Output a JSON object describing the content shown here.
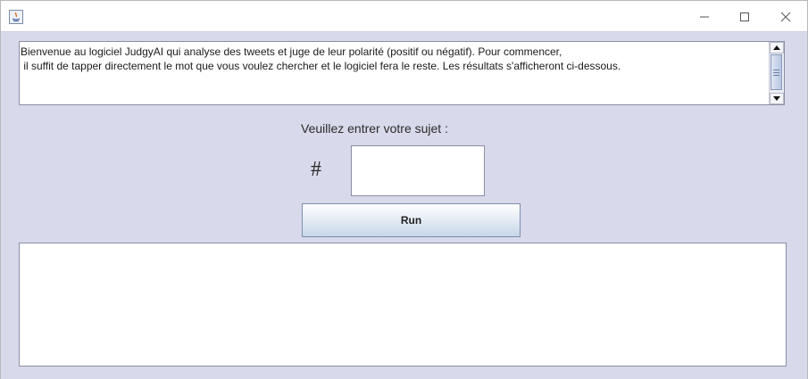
{
  "window": {
    "title": "",
    "controls": [
      "minimize-icon",
      "maximize-icon",
      "close-icon"
    ]
  },
  "intro": {
    "text": "Bienvenue au logiciel JudgyAI qui analyse des tweets et juge de leur polarité (positif ou négatif). Pour commencer,\n il suffit de tapper directement le mot que vous voulez chercher et le logiciel fera le reste. Les résultats s'afficheront ci-dessous."
  },
  "form": {
    "prompt": "Veuillez entrer votre sujet :",
    "hash": "#",
    "subject_value": "",
    "run_label": "Run"
  },
  "results": {
    "text": ""
  },
  "colors": {
    "panel_bg": "#d8d9ea",
    "border": "#8b8fa5",
    "button_gradient_end": "#c8d6e8"
  }
}
